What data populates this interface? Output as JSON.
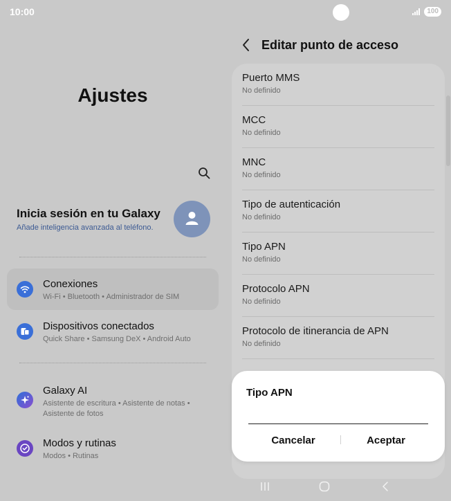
{
  "status_bar": {
    "time": "10:00",
    "battery": "100"
  },
  "left": {
    "title": "Ajustes",
    "account": {
      "title": "Inicia sesión en tu Galaxy",
      "subtitle": "Añade inteligencia avanzada al teléfono."
    },
    "items": [
      {
        "label": "Conexiones",
        "sub": "Wi-Fi  •  Bluetooth  •  Administrador de SIM",
        "icon": "wifi-icon",
        "color": "#3a6fd8"
      },
      {
        "label": "Dispositivos conectados",
        "sub": "Quick Share  •  Samsung DeX  •  Android Auto",
        "icon": "devices-icon",
        "color": "#3a6fd8"
      },
      {
        "label": "Galaxy AI",
        "sub": "Asistente de escritura  •  Asistente de notas  •  Asistente de fotos",
        "icon": "galaxy-ai-icon",
        "color": "#6a5bd0"
      },
      {
        "label": "Modos y rutinas",
        "sub": "Modos  •  Rutinas",
        "icon": "modes-icon",
        "color": "#6a46c2"
      }
    ]
  },
  "right": {
    "title": "Editar punto de acceso",
    "fields": [
      {
        "label": "Puerto MMS",
        "value": "No definido"
      },
      {
        "label": "MCC",
        "value": "No definido"
      },
      {
        "label": "MNC",
        "value": "No definido"
      },
      {
        "label": "Tipo de autenticación",
        "value": "No definido"
      },
      {
        "label": "Tipo APN",
        "value": "No definido"
      },
      {
        "label": "Protocolo APN",
        "value": "No definido"
      },
      {
        "label": "Protocolo de itinerancia de APN",
        "value": "No definido"
      }
    ]
  },
  "dialog": {
    "title": "Tipo APN",
    "input_value": "",
    "cancel_label": "Cancelar",
    "accept_label": "Aceptar"
  },
  "colors": {
    "background": "#c9c9c9",
    "card": "#d1d1d1",
    "link": "#3c5a93"
  }
}
